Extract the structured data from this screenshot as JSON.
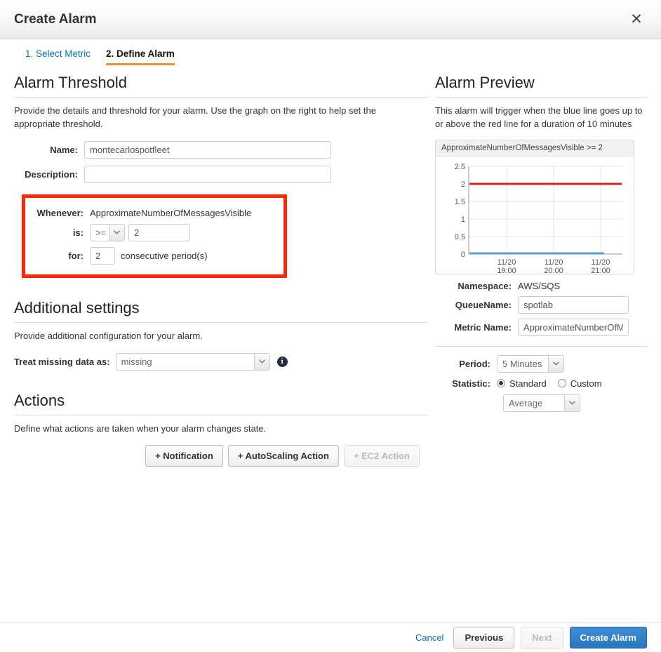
{
  "window": {
    "title": "Create Alarm",
    "close_icon": "close-icon"
  },
  "wizard": {
    "steps": [
      {
        "label": "1. Select Metric",
        "active": false
      },
      {
        "label": "2. Define Alarm",
        "active": true
      }
    ]
  },
  "threshold": {
    "heading": "Alarm Threshold",
    "description": "Provide the details and threshold for your alarm. Use the graph on the right to help set the appropriate threshold.",
    "name_label": "Name:",
    "name_value": "montecarlospotfleet",
    "description_label": "Description:",
    "description_value": "",
    "whenever_label": "Whenever:",
    "whenever_metric": "ApproximateNumberOfMessagesVisible",
    "is_label": "is:",
    "operator_value": ">=",
    "threshold_value": "2",
    "for_label": "for:",
    "periods_value": "2",
    "periods_suffix": "consecutive period(s)",
    "highlight_color": "#ff2600"
  },
  "additional": {
    "heading": "Additional settings",
    "description": "Provide additional configuration for your alarm.",
    "missing_label": "Treat missing data as:",
    "missing_value": "missing",
    "info_icon": "info-icon"
  },
  "actions": {
    "heading": "Actions",
    "description": "Define what actions are taken when your alarm changes state.",
    "buttons": [
      {
        "label": "+ Notification",
        "disabled": false
      },
      {
        "label": "+ AutoScaling Action",
        "disabled": false
      },
      {
        "label": "+ EC2 Action",
        "disabled": true
      }
    ]
  },
  "preview": {
    "heading": "Alarm Preview",
    "description": "This alarm will trigger when the blue line goes up to or above the red line for a duration of 10 minutes",
    "namespace_label": "Namespace:",
    "namespace_value": "AWS/SQS",
    "queuename_label": "QueueName:",
    "queuename_value": "spotlab",
    "metricname_label": "Metric Name:",
    "metricname_value": "ApproximateNumberOfM",
    "period_label": "Period:",
    "period_value": "5 Minutes",
    "statistic_label": "Statistic:",
    "statistic_standard": "Standard",
    "statistic_custom": "Custom",
    "statistic_selected": "standard",
    "statistic_function": "Average"
  },
  "footer": {
    "cancel": "Cancel",
    "previous": "Previous",
    "next": "Next",
    "create": "Create Alarm",
    "next_disabled": true,
    "primary_color": "#2a74c0"
  },
  "chart_data": {
    "type": "line",
    "title": "ApproximateNumberOfMessagesVisible >= 2",
    "xlabel": "",
    "ylabel": "",
    "ylim": [
      0,
      2.5
    ],
    "yticks": [
      "0",
      "0.5",
      "1",
      "1.5",
      "2",
      "2.5"
    ],
    "ytick_values": [
      0,
      0.5,
      1,
      1.5,
      2,
      2.5
    ],
    "xticks": [
      "11/20\n19:00",
      "11/20\n20:00",
      "11/20\n21:00"
    ],
    "xtick_labels_line1": [
      "11/20",
      "11/20",
      "11/20"
    ],
    "xtick_labels_line2": [
      "19:00",
      "20:00",
      "21:00"
    ],
    "grid": true,
    "legend": "none",
    "series": [
      {
        "name": "ApproximateNumberOfMessagesVisible",
        "color": "#5b9bd5",
        "values": [
          0,
          0,
          0,
          0,
          0,
          0,
          0,
          0,
          0,
          0
        ],
        "kind": "metric"
      },
      {
        "name": "Threshold",
        "color": "#ee1b1b",
        "values": [
          2,
          2,
          2,
          2,
          2,
          2,
          2,
          2,
          2,
          2
        ],
        "kind": "threshold"
      }
    ]
  }
}
